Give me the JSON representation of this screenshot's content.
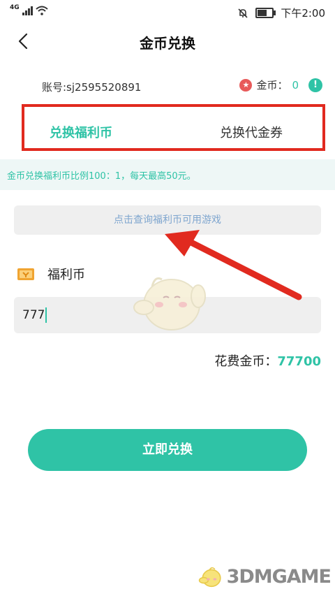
{
  "status_bar": {
    "network": "4G",
    "time": "下午2:00",
    "battery_level": 0.8
  },
  "nav": {
    "title": "金币兑换",
    "back_icon": "chevron-left-icon"
  },
  "account": {
    "label": "账号:sj2595520891",
    "coin_label": "金币：",
    "coin_value": "0",
    "info_icon": "!"
  },
  "tabs": [
    {
      "label": "兑换福利币",
      "active": true
    },
    {
      "label": "兑换代金券",
      "active": false
    }
  ],
  "notice": {
    "text": "金币兑换福利币比例100：1，每天最高50元。"
  },
  "query_button": {
    "label": "点击查询福利币可用游戏"
  },
  "currency": {
    "label": "福利币"
  },
  "amount_input": {
    "value": "777"
  },
  "cost": {
    "label": "花费金币：",
    "value": "77700"
  },
  "submit_button": {
    "label": "立即兑换"
  },
  "watermark": {
    "text": "3DMGAME"
  },
  "colors": {
    "accent": "#2fc3a6",
    "highlight_box": "#e12a1f",
    "arrow": "#e12a1f",
    "notice_bg": "#eef7f6"
  }
}
